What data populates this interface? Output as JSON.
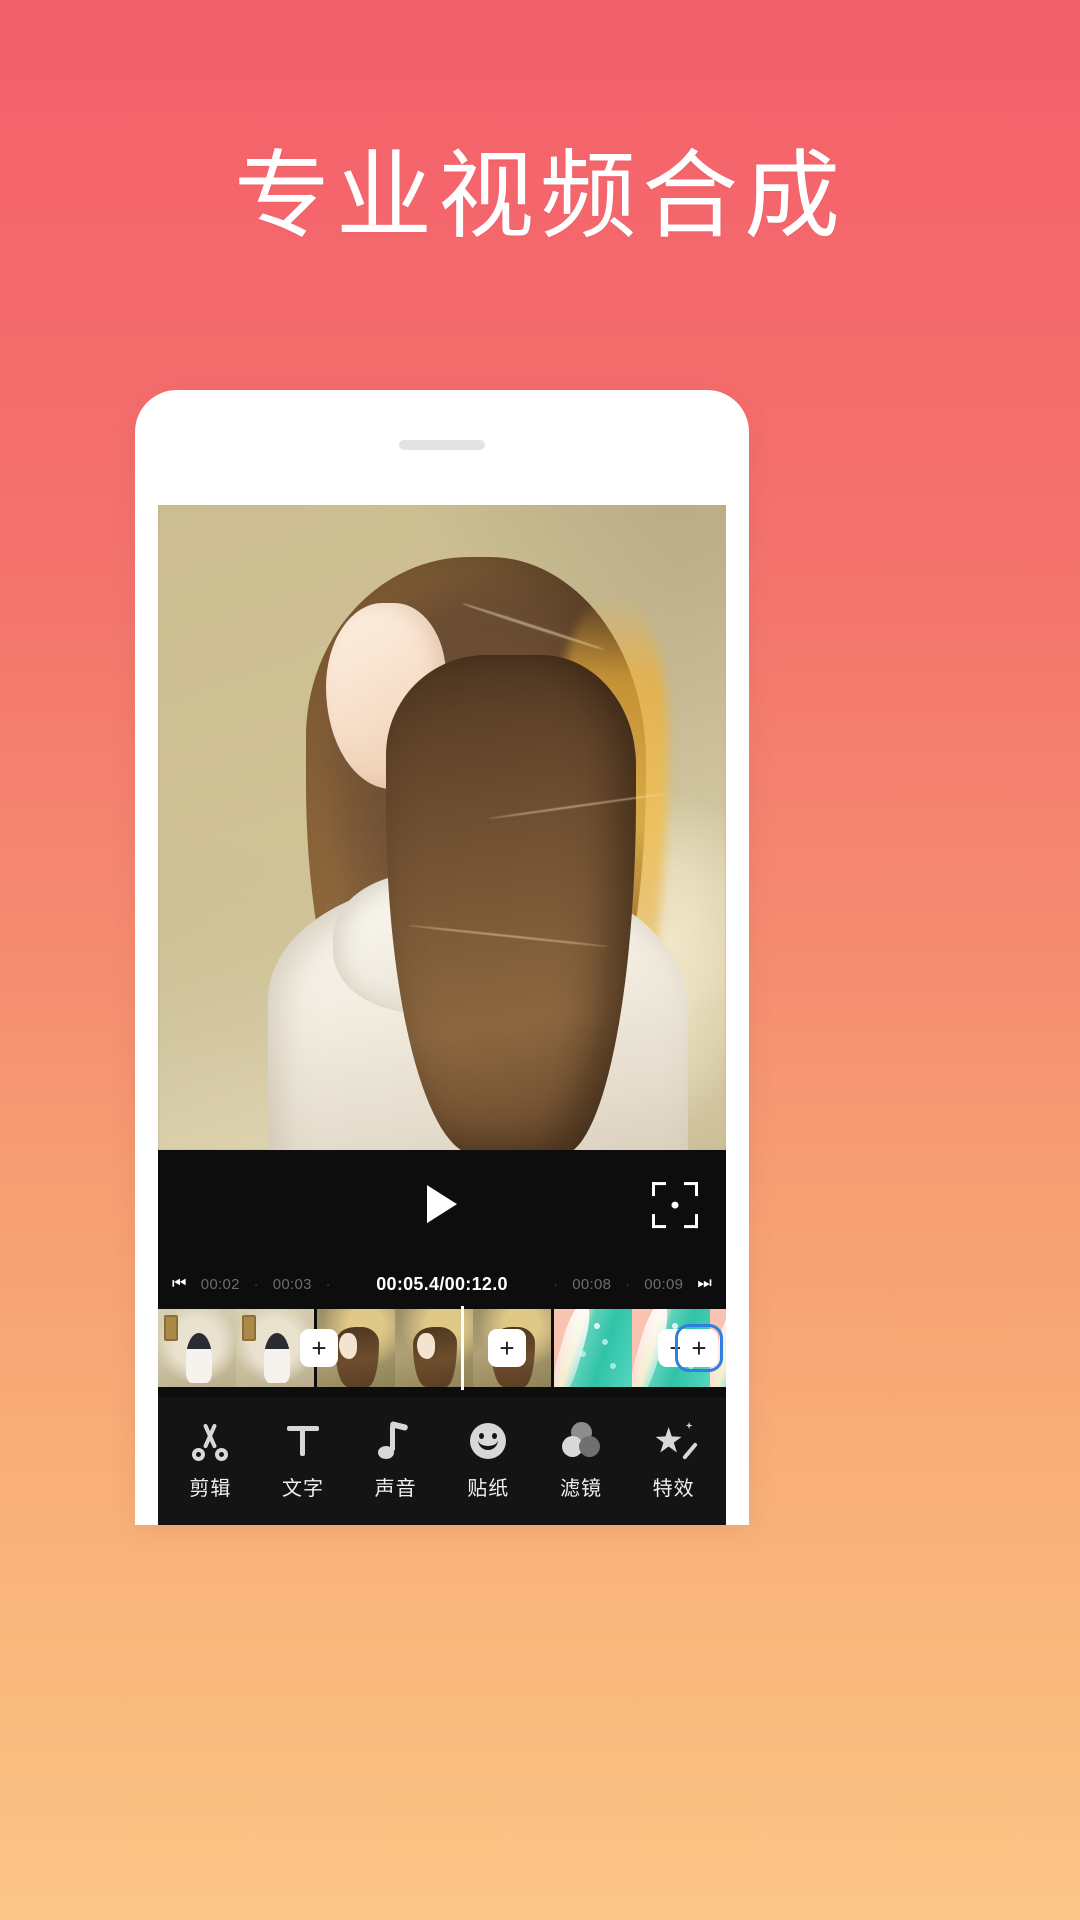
{
  "page": {
    "headline": "专业视频合成",
    "background_top_color": "#f2606a",
    "background_bottom_color": "#fbc687"
  },
  "phone": {
    "speaker_name": "speaker-grill"
  },
  "player": {
    "play_icon": "play-icon",
    "fullscreen_icon": "fullscreen-icon"
  },
  "timeline": {
    "skip_back_icon": "skip-previous-icon",
    "skip_forward_icon": "skip-next-icon",
    "current_time": "00:05.4",
    "total_time": "00:12.0",
    "current_display": "00:05.4/00:12.0",
    "left_ticks": [
      "00:02",
      "00:03"
    ],
    "right_ticks": [
      "00:08",
      "00:09"
    ],
    "dot": "·"
  },
  "clips": {
    "add_label": "+",
    "selected_add_label": "+",
    "tracks": [
      {
        "id": "clip-1",
        "frames": 2,
        "style": "a"
      },
      {
        "id": "clip-2",
        "frames": 3,
        "style": "b"
      },
      {
        "id": "clip-3",
        "frames": 3,
        "style": "c"
      }
    ]
  },
  "toolbar": {
    "items": [
      {
        "icon": "scissors-icon",
        "label": "剪辑"
      },
      {
        "icon": "text-icon",
        "label": "文字"
      },
      {
        "icon": "music-note-icon",
        "label": "声音"
      },
      {
        "icon": "smiley-icon",
        "label": "贴纸"
      },
      {
        "icon": "filter-circles-icon",
        "label": "滤镜"
      },
      {
        "icon": "magic-star-icon",
        "label": "特效"
      }
    ]
  }
}
